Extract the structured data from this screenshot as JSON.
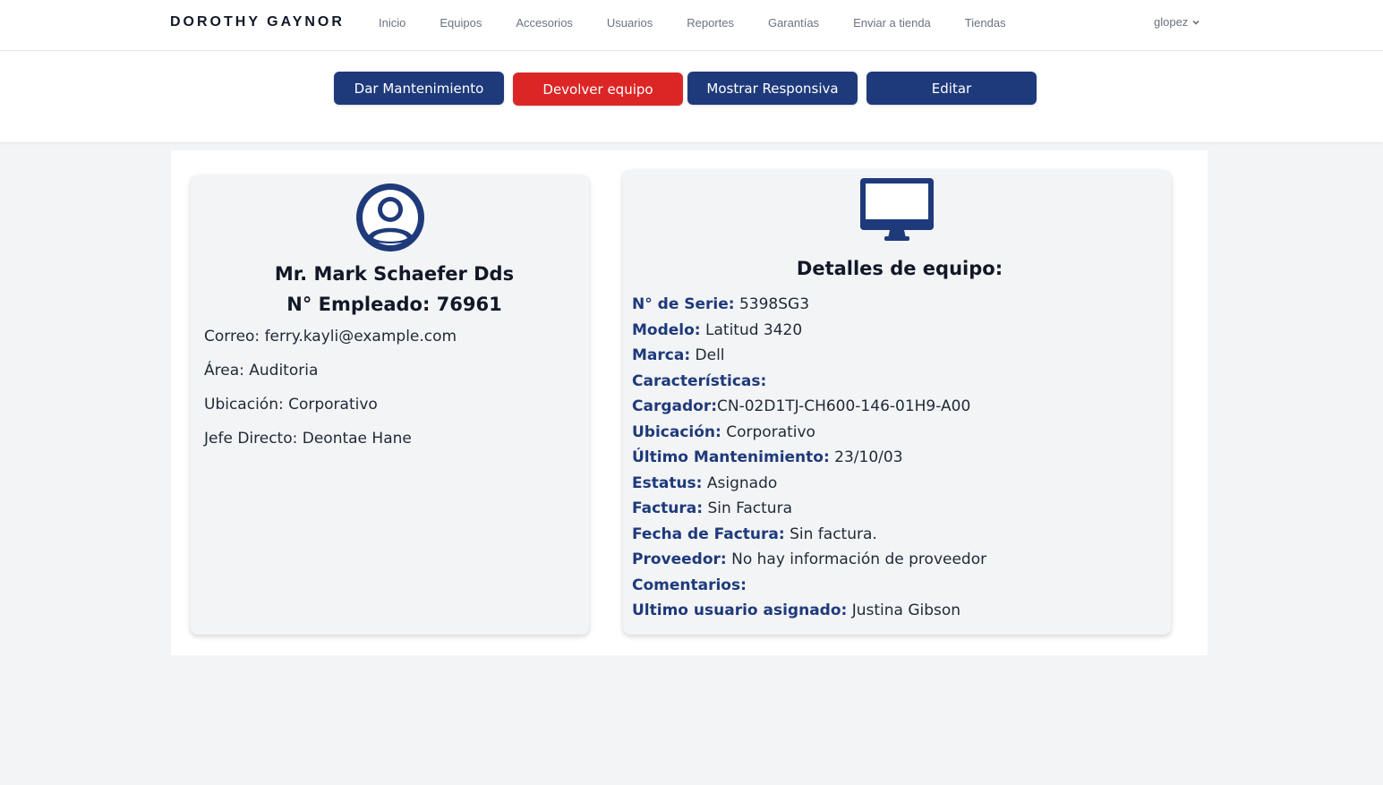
{
  "nav": {
    "brand": "DOROTHY GAYNOR",
    "links": [
      "Inicio",
      "Equipos",
      "Accesorios",
      "Usuarios",
      "Reportes",
      "Garantías",
      "Enviar a tienda",
      "Tiendas"
    ],
    "user": "glopez"
  },
  "actions": {
    "maintenance": "Dar Mantenimiento",
    "return": "Devolver equipo",
    "responsive": "Mostrar Responsiva",
    "edit": "Editar"
  },
  "user_card": {
    "name": "Mr. Mark Schaefer Dds",
    "employee": "N° Empleado: 76961",
    "email": "Correo: ferry.kayli@example.com",
    "area": "Área: Auditoria",
    "location": "Ubicación: Corporativo",
    "boss": "Jefe Directo: Deontae Hane"
  },
  "equipment": {
    "title": "Detalles de equipo:",
    "details": [
      {
        "label": "N° de Serie:",
        "value": " 5398SG3"
      },
      {
        "label": "Modelo:",
        "value": " Latitud 3420"
      },
      {
        "label": "Marca:",
        "value": " Dell"
      },
      {
        "label": "Características:",
        "value": ""
      },
      {
        "label": "Cargador:",
        "value": "CN-02D1TJ-CH600-146-01H9-A00"
      },
      {
        "label": "Ubicación:",
        "value": " Corporativo"
      },
      {
        "label": "Último Mantenimiento:",
        "value": " 23/10/03"
      },
      {
        "label": "Estatus:",
        "value": " Asignado"
      },
      {
        "label": "Factura:",
        "value": " Sin Factura"
      },
      {
        "label": "Fecha de Factura:",
        "value": " Sin factura."
      },
      {
        "label": "Proveedor:",
        "value": " No hay información de proveedor"
      },
      {
        "label": "Comentarios:",
        "value": ""
      },
      {
        "label": "Ultimo usuario asignado:",
        "value": " Justina Gibson"
      }
    ]
  },
  "colors": {
    "primary": "#1e3a7b",
    "danger": "#dc2626",
    "background": "#f3f4f6"
  }
}
